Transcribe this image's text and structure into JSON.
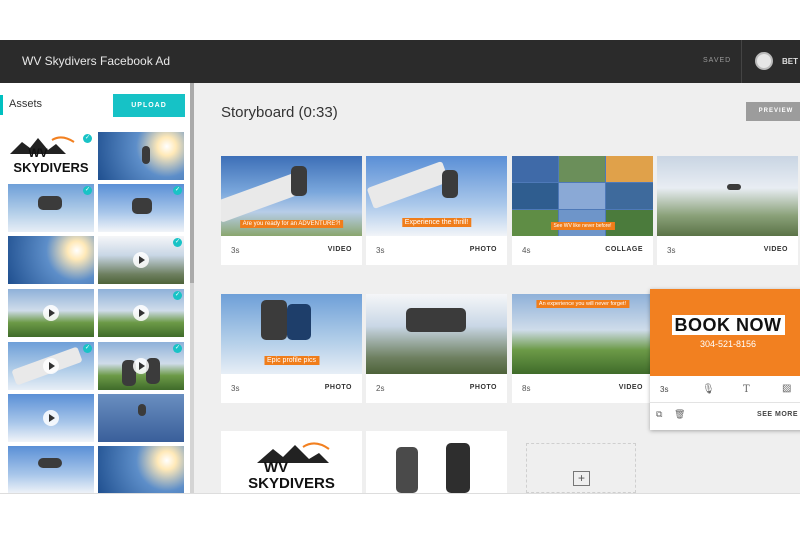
{
  "header": {
    "title": "WV Skydivers Facebook Ad",
    "status": "SAVED",
    "user": "BET"
  },
  "sidebar": {
    "label": "Assets",
    "upload_label": "UPLOAD",
    "logo_line1": "WV",
    "logo_line2": "SKYDIVERS"
  },
  "storyboard": {
    "title": "Storyboard (0:33)",
    "preview_label": "PREVIEW",
    "cards": [
      {
        "duration": "3s",
        "type": "VIDEO",
        "caption": "Are you ready for an ADVENTURE?!"
      },
      {
        "duration": "3s",
        "type": "PHOTO",
        "caption": "Experience the thrill!"
      },
      {
        "duration": "4s",
        "type": "COLLAGE",
        "caption": "See WV like never before!"
      },
      {
        "duration": "3s",
        "type": "VIDEO",
        "caption": ""
      },
      {
        "duration": "3s",
        "type": "PHOTO",
        "caption": "Epic profile pics"
      },
      {
        "duration": "2s",
        "type": "PHOTO",
        "caption": ""
      },
      {
        "duration": "8s",
        "type": "VIDEO",
        "caption": "An experience you will never forget!"
      }
    ],
    "book_now": {
      "headline": "BOOK NOW",
      "phone": "304-521-8156",
      "duration": "3s",
      "see_more": "SEE MORE"
    },
    "logo_card": {
      "line1": "WV",
      "line2": "SKYDIVERS"
    }
  },
  "colors": {
    "accent": "#16c2c6",
    "orange": "#f28020",
    "header": "#2b2b2b"
  },
  "icons": [
    "check-icon",
    "play-icon",
    "microphone-icon",
    "text-icon",
    "image-icon",
    "duplicate-icon",
    "trash-icon",
    "add-icon"
  ]
}
